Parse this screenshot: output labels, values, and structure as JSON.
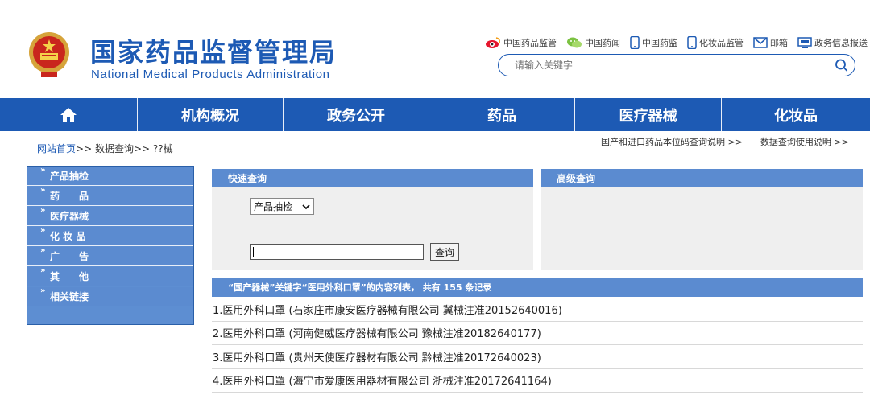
{
  "header": {
    "title_cn": "国家药品监督管理局",
    "title_en": "National Medical Products Administration",
    "toplinks": [
      {
        "label": "中国药品监管",
        "icon": "weibo-icon"
      },
      {
        "label": "中国药闻",
        "icon": "wechat-icon"
      },
      {
        "label": "中国药监",
        "icon": "mobile-icon"
      },
      {
        "label": "化妆品监管",
        "icon": "mobile-icon"
      },
      {
        "label": "邮箱",
        "icon": "mail-icon"
      },
      {
        "label": "政务信息报送",
        "icon": "monitor-icon"
      }
    ],
    "search_placeholder": "请输入关键字"
  },
  "nav": {
    "home_icon": "home-icon",
    "items": [
      "机构概况",
      "政务公开",
      "药品",
      "医疗器械",
      "化妆品"
    ]
  },
  "breadcrumb": {
    "home": "网站首页",
    "rest": ">> 数据查询>> ??械"
  },
  "rightlinks": [
    "国产和进口药品本位码查询说明 >>",
    "数据查询使用说明 >>"
  ],
  "sidebar": {
    "items": [
      "产品抽检",
      "药　　品",
      "医疗器械",
      "化 妆 品",
      "广　　告",
      "其　　他",
      "相关链接"
    ]
  },
  "quick_search": {
    "title": "快速查询",
    "select_value": "产品抽检",
    "button_label": "查询"
  },
  "advanced_search": {
    "title": "高级查询"
  },
  "results": {
    "header": "“国产器械”关键字“医用外科口罩”的内容列表， 共有 155 条记录",
    "rows": [
      "1.医用外科口罩 (石家庄市康安医疗器械有限公司 冀械注准20152640016)",
      "2.医用外科口罩 (河南健威医疗器械有限公司 豫械注准20182640177)",
      "3.医用外科口罩 (贵州天使医疗器材有限公司 黔械注准20172640023)",
      "4.医用外科口罩 (海宁市爱康医用器材有限公司 浙械注准20172641164)"
    ]
  },
  "colors": {
    "brand_blue": "#1d5ab4",
    "panel_blue": "#5b8bd0",
    "panel_gray": "#efefef"
  }
}
